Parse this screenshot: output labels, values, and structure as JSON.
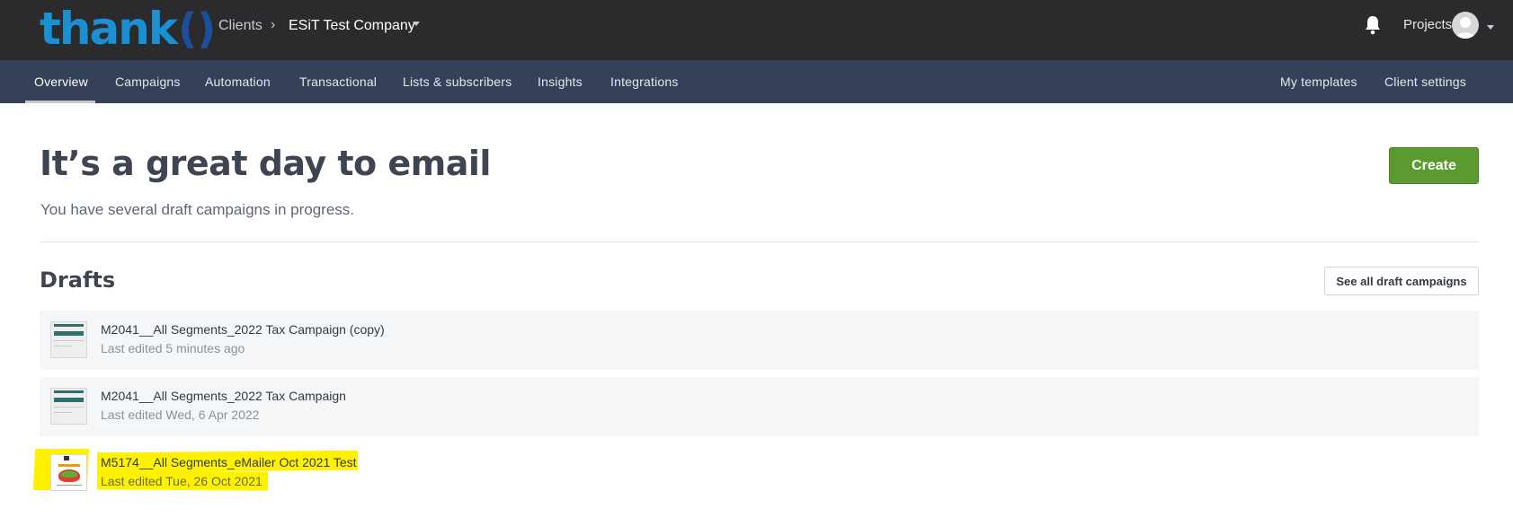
{
  "brand": {
    "logo_text": "thank",
    "logo_mark": "()",
    "logo_color": "#1a8fd1"
  },
  "header": {
    "breadcrumb_root": "Clients",
    "breadcrumb_sep": "›",
    "company": "ESiT Test Company",
    "projects_label": "Projects",
    "icons": [
      "bell-icon",
      "avatar",
      "chevron-down-icon"
    ]
  },
  "nav": {
    "items": [
      {
        "label": "Overview",
        "active": true
      },
      {
        "label": "Campaigns"
      },
      {
        "label": "Automation"
      },
      {
        "label": "Transactional"
      },
      {
        "label": "Lists & subscribers"
      },
      {
        "label": "Insights"
      },
      {
        "label": "Integrations"
      }
    ],
    "right_items": [
      {
        "label": "My templates"
      },
      {
        "label": "Client settings"
      }
    ]
  },
  "main": {
    "headline": "It’s a great day to email",
    "subhead": "You have several draft campaigns in progress.",
    "create_label": "Create"
  },
  "drafts": {
    "title": "Drafts",
    "see_all_label": "See all draft campaigns",
    "rows": [
      {
        "title": "M2041__All Segments_2022 Tax Campaign (copy)",
        "edited": "Last edited 5 minutes ago"
      },
      {
        "title": "M2041__All Segments_2022 Tax Campaign",
        "edited": "Last edited Wed, 6 Apr 2022"
      },
      {
        "title": "M5174__All Segments_eMailer Oct 2021 Test",
        "edited": "Last edited Tue, 26 Oct 2021",
        "highlighted": true
      }
    ]
  },
  "colors": {
    "topbar": "#2b2b2e",
    "nav": "#364058",
    "create": "#5b9a2e",
    "highlight": "#fff200"
  }
}
